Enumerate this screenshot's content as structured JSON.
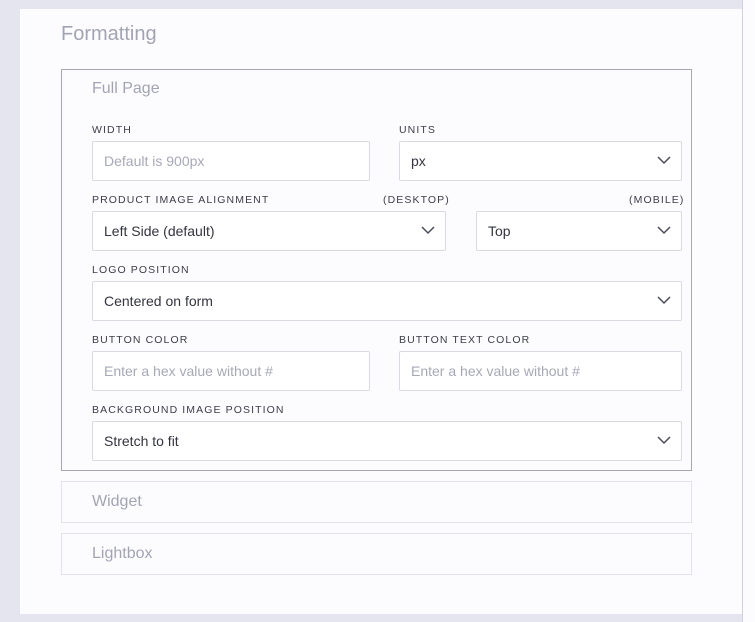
{
  "section_title": "Formatting",
  "panels": {
    "full_page": {
      "title": "Full Page",
      "width": {
        "label": "WIDTH",
        "placeholder": "Default is 900px"
      },
      "units": {
        "label": "UNITS",
        "value": "px"
      },
      "alignment": {
        "label": "PRODUCT IMAGE ALIGNMENT",
        "desktop_label": "(DESKTOP)",
        "mobile_label": "(MOBILE)",
        "desktop_value": "Left Side (default)",
        "mobile_value": "Top"
      },
      "logo_position": {
        "label": "LOGO POSITION",
        "value": "Centered on form"
      },
      "button_color": {
        "label": "BUTTON COLOR",
        "placeholder": "Enter a hex value without #"
      },
      "button_text_color": {
        "label": "BUTTON TEXT COLOR",
        "placeholder": "Enter a hex value without #"
      },
      "background_image_position": {
        "label": "BACKGROUND IMAGE POSITION",
        "value": "Stretch to fit"
      }
    },
    "widget": {
      "title": "Widget"
    },
    "lightbox": {
      "title": "Lightbox"
    }
  }
}
